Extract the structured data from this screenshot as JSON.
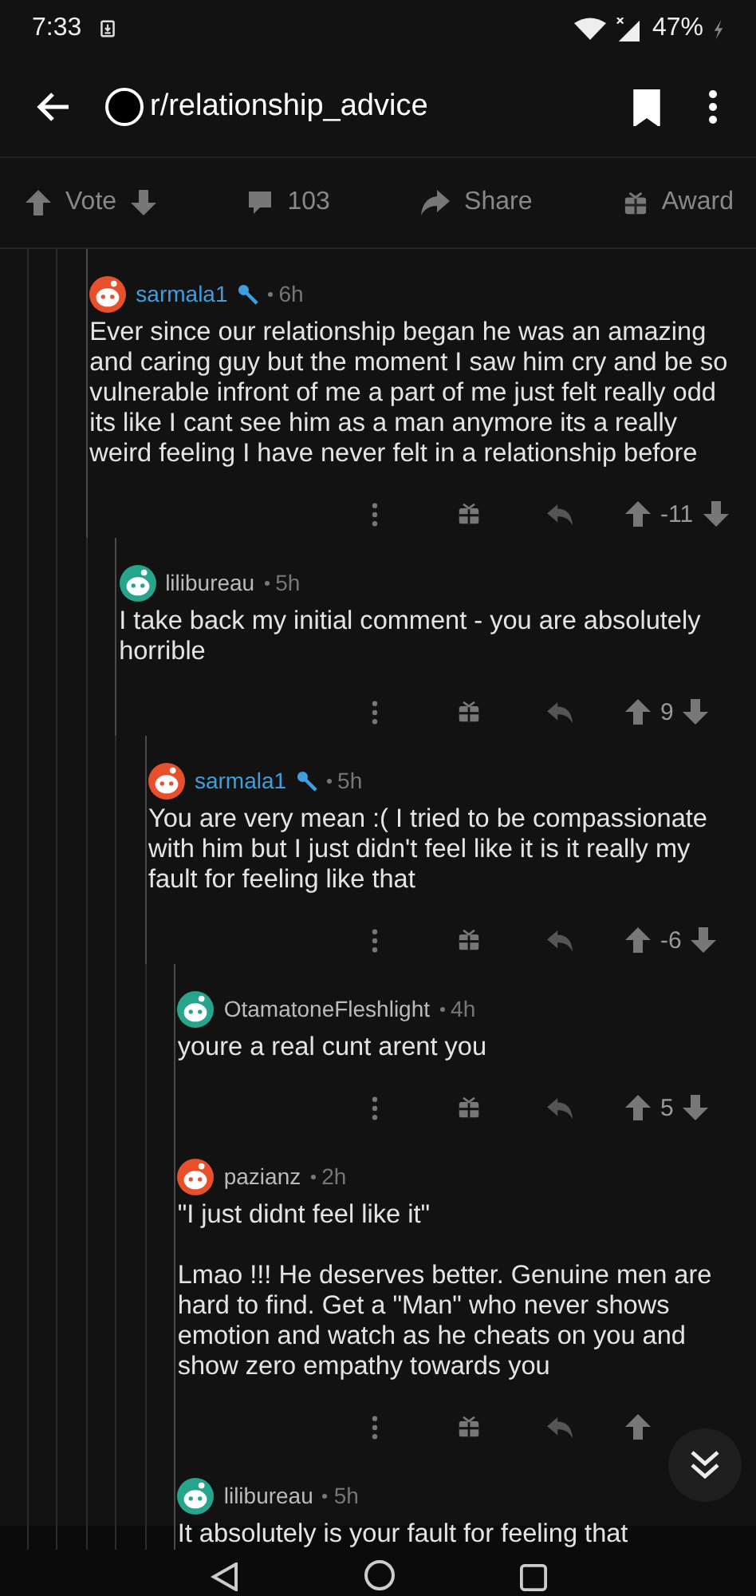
{
  "status_bar": {
    "time": "7:33",
    "battery": "47%",
    "charging": true
  },
  "header": {
    "title": "r/relationship_advice",
    "saved": true
  },
  "post_actions": {
    "vote": "Vote",
    "comments": "103",
    "share": "Share",
    "award": "Award"
  },
  "comments": [
    {
      "author": "sarmala1",
      "op": true,
      "color": "#e8502b",
      "time": "6h",
      "paragraphs": [
        "Ever since our relationship began he was an amazing and caring guy but the moment I saw him cry and be so vulnerable infront of me a part of me just felt really odd its like I cant see him as a man anymore its a really weird feeling I have never felt in a relationship before"
      ],
      "score": "-11",
      "children": [
        {
          "author": "lilibureau",
          "op": false,
          "color": "#27a58c",
          "time": "5h",
          "paragraphs": [
            "I take back my initial comment - you are absolutely horrible"
          ],
          "score": "9",
          "children": [
            {
              "author": "sarmala1",
              "op": true,
              "color": "#e8502b",
              "time": "5h",
              "paragraphs": [
                "You are very mean :( I tried to be compassionate with him but I just didn't feel like it is it really my fault for feeling like that"
              ],
              "score": "-6",
              "children": [
                {
                  "author": "OtamatoneFleshlight",
                  "op": false,
                  "color": "#27a58c",
                  "time": "4h",
                  "paragraphs": [
                    "youre a real cunt arent you"
                  ],
                  "score": "5"
                },
                {
                  "author": "pazianz",
                  "op": false,
                  "color": "#e8502b",
                  "time": "2h",
                  "paragraphs": [
                    "\"I just didnt feel like it\"",
                    "Lmao !!! He deserves better. Genuine men are hard to find. Get a \"Man\" who never shows emotion and watch as he cheats on you and show zero empathy towards you"
                  ]
                },
                {
                  "author": "lilibureau",
                  "op": false,
                  "color": "#27a58c",
                  "time": "5h",
                  "paragraphs": [
                    "It absolutely is your fault for feeling that"
                  ]
                }
              ]
            }
          ]
        }
      ]
    }
  ]
}
